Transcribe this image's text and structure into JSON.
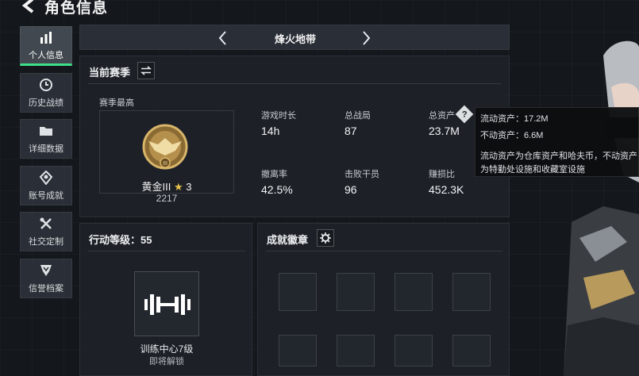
{
  "header": {
    "title": "角色信息"
  },
  "sidebar": {
    "items": [
      {
        "label": "个人信息",
        "icon": "bar-chart-icon",
        "active": true
      },
      {
        "label": "历史战绩",
        "icon": "clock-icon",
        "active": false
      },
      {
        "label": "详细数据",
        "icon": "folder-icon",
        "active": false
      },
      {
        "label": "账号成就",
        "icon": "medal-icon",
        "active": false
      },
      {
        "label": "社交定制",
        "icon": "tools-icon",
        "active": false
      },
      {
        "label": "信誉档案",
        "icon": "shield-icon",
        "active": false
      }
    ]
  },
  "mode": {
    "title": "烽火地带"
  },
  "season": {
    "title": "当前赛季",
    "best_label": "赛季最高",
    "rank_name": "黄金III",
    "rank_stars": "3",
    "rank_points": "2217",
    "stats": [
      {
        "label": "游戏时长",
        "value": "14h"
      },
      {
        "label": "总战局",
        "value": "87"
      },
      {
        "label": "总资产",
        "value": "23.7M"
      },
      {
        "label": "撤离率",
        "value": "42.5%"
      },
      {
        "label": "击败干员",
        "value": "96"
      },
      {
        "label": "赚损比",
        "value": "452.3K"
      }
    ]
  },
  "level": {
    "title": "行动等级：55",
    "center_name": "训练中心7级",
    "center_status": "即将解锁"
  },
  "badges": {
    "title": "成就徽章"
  },
  "tooltip": {
    "liquid": "流动资产：17.2M",
    "fixed": "不动资产：6.6M",
    "desc1": "流动资产为仓库资产和哈夫币，不动资产",
    "desc2": "为特勤处设施和收藏室设施"
  },
  "colors": {
    "accent": "#3ee08a",
    "gold": "#c9a35a"
  }
}
